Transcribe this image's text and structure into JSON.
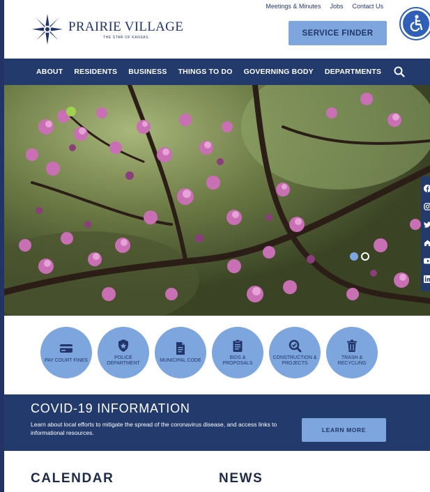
{
  "brand": {
    "name": "PRAIRIE VILLAGE",
    "tagline": "THE STAR OF KANSAS"
  },
  "utility_links": [
    "Meetings & Minutes",
    "Jobs",
    "Contact Us"
  ],
  "service_finder_label": "SERVICE FINDER",
  "nav": {
    "items": [
      "ABOUT",
      "RESIDENTS",
      "BUSINESS",
      "THINGS TO DO",
      "GOVERNING BODY",
      "DEPARTMENTS"
    ]
  },
  "carousel": {
    "slide_count": 2,
    "active_slide": 1
  },
  "social_icons": [
    "facebook-icon",
    "instagram-icon",
    "twitter-icon",
    "nextdoor-icon",
    "youtube-icon",
    "linkedin-icon"
  ],
  "quick_links": [
    {
      "label": "PAY COURT FINES",
      "icon": "credit-card-icon"
    },
    {
      "label": "POLICE DEPARTMENT",
      "icon": "badge-icon"
    },
    {
      "label": "MUNICIPAL CODE",
      "icon": "document-icon"
    },
    {
      "label": "BIDS & PROPOSALS",
      "icon": "clipboard-icon"
    },
    {
      "label": "CONSTRUCTION & PROJECTS",
      "icon": "construction-icon"
    },
    {
      "label": "TRASH & RECYCLING",
      "icon": "trash-icon"
    }
  ],
  "covid": {
    "title": "COVID-19 INFORMATION",
    "text": "Learn about local efforts to mitigate the spread of the coronavirus disease, and access links to informational resources.",
    "button": "LEARN MORE"
  },
  "sections": {
    "calendar": "CALENDAR",
    "news": "NEWS"
  },
  "colors": {
    "navy": "#233a6c",
    "light_blue": "#7ca6dd",
    "accessibility_blue": "#2f5fb6"
  }
}
